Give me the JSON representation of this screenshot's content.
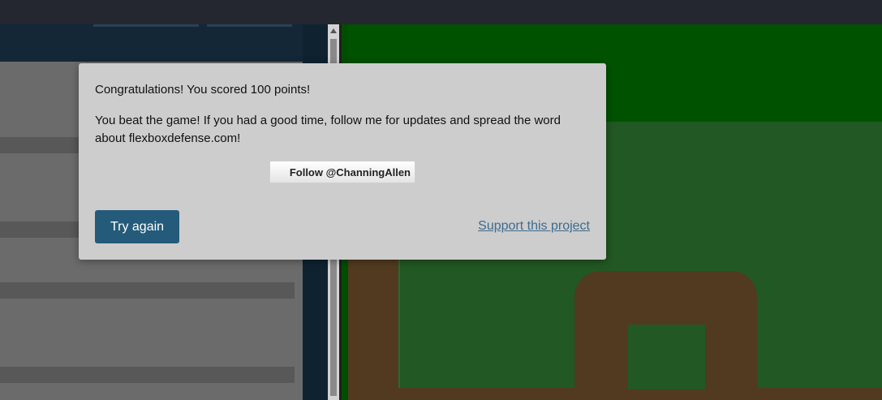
{
  "modal": {
    "score_message": "Congratulations! You scored 100 points!",
    "beat_message": "You beat the game! If you had a good time, follow me for updates and spread the word about flexboxdefense.com!",
    "follow_label": "Follow @ChanningAllen",
    "try_again_label": "Try again",
    "support_label": "Support this project"
  },
  "colors": {
    "modal_bg": "#cdcdcd",
    "primary_button": "#245b7a",
    "link": "#3d6c8e",
    "grass": "#2b6b2b",
    "path": "#513a20"
  },
  "icons": {
    "follow": "bird-icon",
    "scroll_up": "arrow-up-icon"
  }
}
